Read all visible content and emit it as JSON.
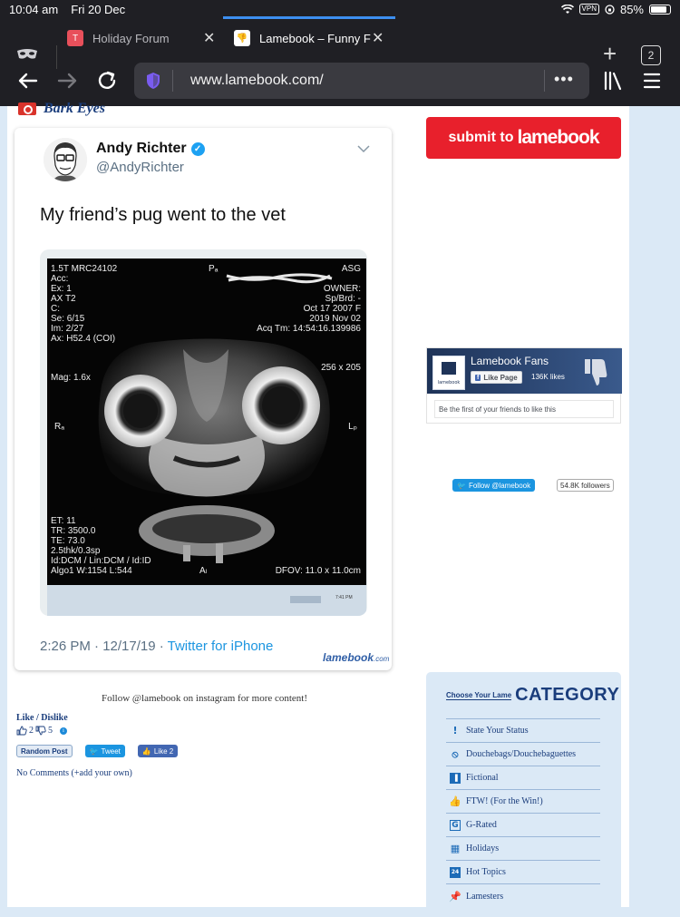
{
  "status_bar": {
    "time": "10:04 am",
    "date": "Fri 20 Dec",
    "vpn": "VPN",
    "battery": "85%",
    "battery_level": 0.85
  },
  "tabs": [
    {
      "label": "Holiday Forum",
      "favicon_letter": "T",
      "active": false
    },
    {
      "label": "Lamebook – Funny F",
      "active": true
    }
  ],
  "tab_count": "2",
  "url": "www.lamebook.com/",
  "post": {
    "title": "Bark Eyes",
    "tweet": {
      "name": "Andy Richter",
      "handle": "@AndyRichter",
      "text": "My friend’s pug went to the vet",
      "time": "2:26 PM · 12/17/19 · ",
      "source": "Twitter for iPhone",
      "watermark": "lamebook",
      "watermark_suffix": ".com"
    },
    "mri": {
      "top_left": [
        "1.5T MRC24102",
        "Acc:",
        "Ex: 1",
        "AX T2",
        "C:",
        "Se: 6/15",
        "Im: 2/27",
        "Ax: H52.4 (COI)"
      ],
      "mag": "Mag: 1.6x",
      "top_center": "Pₐ",
      "top_right": [
        "ASG",
        "OWNER:",
        "Sp/Brd: -",
        "Oct 17 2007 F",
        "2019 Nov 02",
        "Acq Tm: 14:54:16.139986"
      ],
      "size": "256 x 205",
      "left_mid": "Rₐ",
      "right_mid": "Lₚ",
      "bottom_left": [
        "ET: 11",
        "TR: 3500.0",
        "TE: 73.0",
        "2.5thk/0.3sp",
        "Id:DCM / Lin:DCM / Id:ID",
        "Algo1 W:1154  L:544"
      ],
      "bottom_center": "Aₗ",
      "dfov": "DFOV: 11.0 x 11.0cm",
      "clock": "7:41 PM"
    },
    "instagram_line": "Follow @lamebook on instagram for more content!",
    "like_label": "Like / Dislike",
    "likes": "2",
    "dislikes": "5",
    "random_post": "Random Post",
    "tweet_btn": "Tweet",
    "fb_like_btn": "Like 2",
    "comments_link": "No Comments (+add your own)"
  },
  "sidebar": {
    "submit_prefix": "submit to",
    "submit_brand": "lamebook",
    "fb": {
      "page_name": "Lamebook Fans",
      "like_page": "Like Page",
      "like_count": "136K likes",
      "friends_line": "Be the first of your friends to like this"
    },
    "twitter": {
      "follow": "Follow @lamebook",
      "followers": "54.8K followers"
    },
    "category": {
      "small_line1": "Choose Your Lame",
      "big": "CATEGORY",
      "items": [
        {
          "label": "State Your Status",
          "icon": "exclamation-icon"
        },
        {
          "label": "Douchebags/Douchebaguettes",
          "icon": "prohibited-icon"
        },
        {
          "label": "Fictional",
          "icon": "book-icon"
        },
        {
          "label": "FTW! (For the Win!)",
          "icon": "thumbs-up-icon"
        },
        {
          "label": "G-Rated",
          "icon": "g-icon"
        },
        {
          "label": "Holidays",
          "icon": "gift-icon"
        },
        {
          "label": "Hot Topics",
          "icon": "calendar-icon"
        },
        {
          "label": "Lamesters",
          "icon": "pin-icon"
        }
      ]
    }
  }
}
